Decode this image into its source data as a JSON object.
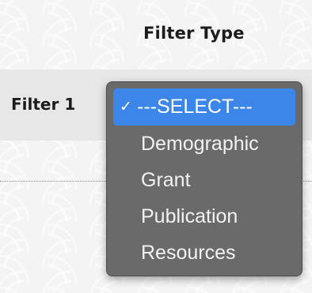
{
  "header": {
    "title": "Filter Type"
  },
  "row": {
    "label": "Filter 1"
  },
  "dropdown": {
    "check_glyph": "✓",
    "selected_value": "---SELECT---",
    "options": [
      {
        "label": "---SELECT---",
        "selected": true
      },
      {
        "label": "Demographic",
        "selected": false
      },
      {
        "label": "Grant",
        "selected": false
      },
      {
        "label": "Publication",
        "selected": false
      },
      {
        "label": "Resources",
        "selected": false
      }
    ]
  },
  "colors": {
    "selection": "#3b86e8",
    "menu_background": "#6a6a6a",
    "row_background": "#e7e7e7"
  }
}
